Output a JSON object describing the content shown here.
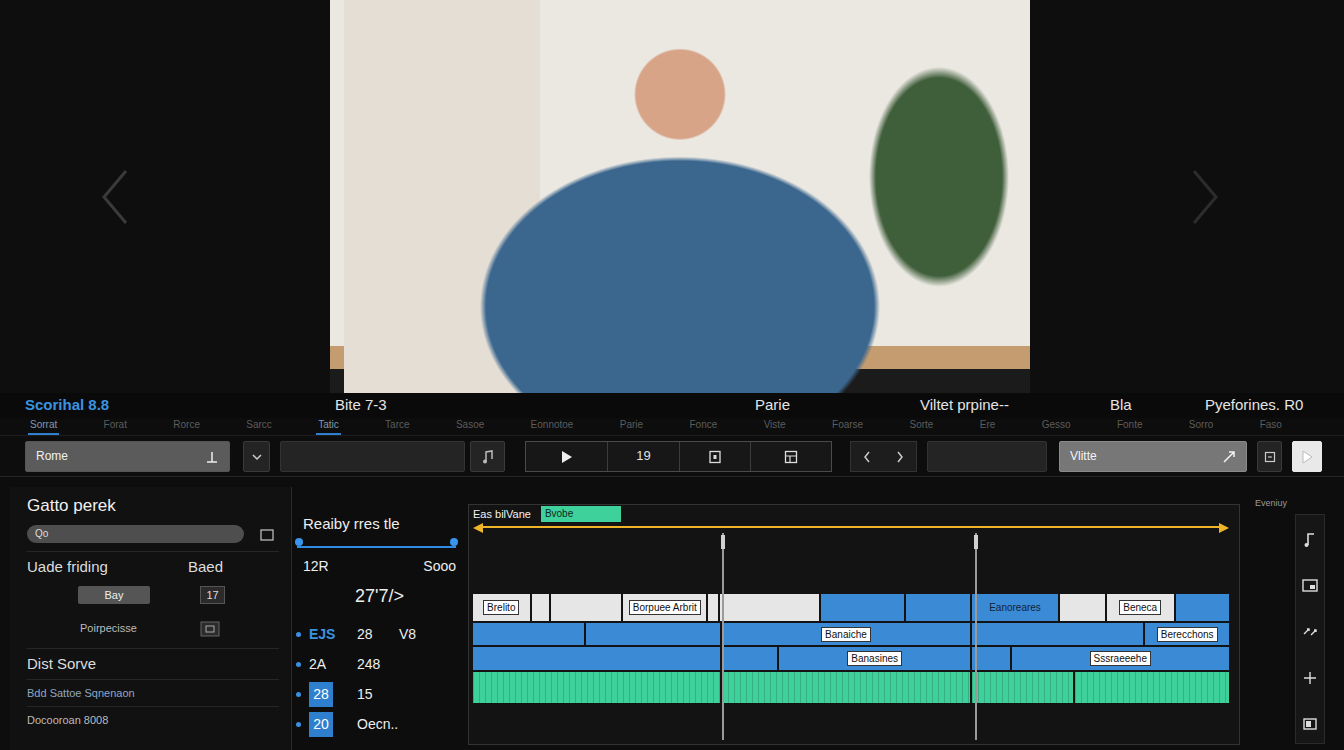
{
  "info_bar": [
    "Scorihal 8.8",
    "Bite  7-3",
    "Parie",
    "Viltet prpine--",
    "Bla",
    "Pyeforines. R0"
  ],
  "tabs": [
    {
      "label": "Sorrat",
      "selected": true
    },
    {
      "label": "Forat",
      "selected": false
    },
    {
      "label": "Rorce",
      "selected": false
    },
    {
      "label": "Sarcc",
      "selected": false
    },
    {
      "label": "Tatic",
      "selected": true
    },
    {
      "label": "Tarce",
      "selected": false
    },
    {
      "label": "Sasoe",
      "selected": false
    },
    {
      "label": "Eonnotoe",
      "selected": false
    },
    {
      "label": "Parie",
      "selected": false
    },
    {
      "label": "Fonce",
      "selected": false
    },
    {
      "label": "Viste",
      "selected": false
    },
    {
      "label": "Foarse",
      "selected": false
    },
    {
      "label": "Sorte",
      "selected": false
    },
    {
      "label": "Ere",
      "selected": false
    },
    {
      "label": "Gesso",
      "selected": false
    },
    {
      "label": "Fonte",
      "selected": false
    },
    {
      "label": "Sorro",
      "selected": false
    },
    {
      "label": "Faso",
      "selected": false
    }
  ],
  "toolbar": {
    "source": "Rome",
    "counter": "19",
    "target": "Vlitte"
  },
  "inspector": {
    "title": "Gatto perek",
    "search": "Qo",
    "row_label": "Uade friding",
    "row_value": "Baed",
    "button": "Bay",
    "button_value": "17",
    "option": "Poirpecisse",
    "section": "Dist Sorve",
    "links": [
      "Bdd Sattoe Sqnenaon",
      "Docooroan 8008"
    ]
  },
  "properties": {
    "title": "Reaiby rres tle",
    "slider": {
      "level": 1
    },
    "min": "12R",
    "max": "Sooo",
    "value": "27'7/>",
    "rows": [
      {
        "kind": "accent",
        "cells": [
          "EJS",
          "28",
          "V8"
        ]
      },
      {
        "kind": "plain",
        "cells": [
          "2A",
          "248"
        ]
      },
      {
        "kind": "boxed",
        "cells": [
          "28",
          "15"
        ]
      },
      {
        "kind": "boxed",
        "cells": [
          "20",
          "Oecn.."
        ]
      }
    ]
  },
  "timeline": {
    "title": "Eas bilVane",
    "tag": "Bvobe",
    "tracks": [
      {
        "kind": "video",
        "clips": [
          {
            "kind": "tag",
            "label": "Brelito",
            "length": 56,
            "color": "#e6e6e6"
          },
          {
            "kind": "plain",
            "length": 17,
            "color": "#e6e6e6"
          },
          {
            "kind": "plain",
            "length": 70,
            "color": "#e6e6e6"
          },
          {
            "kind": "tag",
            "label": "Borpuee Arbrit",
            "length": 82,
            "color": "#e6e6e6"
          },
          {
            "kind": "plain",
            "length": 10,
            "color": "#e6e6e6"
          },
          {
            "kind": "plain",
            "length": 98,
            "color": "#e6e6e6"
          },
          {
            "kind": "plain",
            "length": 82,
            "color": "#3b8ad6"
          },
          {
            "kind": "plain",
            "length": 63,
            "color": "#3b8ad6"
          },
          {
            "kind": "text",
            "label": "Eanoreares",
            "length": 86,
            "color": "#3b8ad6"
          },
          {
            "kind": "plain",
            "length": 44,
            "color": "#e6e6e6"
          },
          {
            "kind": "tag",
            "label": "Beneca",
            "length": 66,
            "color": "#e6e6e6"
          },
          {
            "kind": "plain",
            "length": 53,
            "color": "#3b8ad6"
          }
        ]
      },
      {
        "kind": "video",
        "clips": [
          {
            "kind": "plain",
            "length": 110,
            "color": "#3b8ad6"
          },
          {
            "kind": "plain",
            "length": 133,
            "color": "#3b8ad6"
          },
          {
            "kind": "tag",
            "label": "Banaiche",
            "length": 247,
            "color": "#3b8ad6"
          },
          {
            "kind": "plain",
            "length": 170,
            "color": "#3b8ad6"
          },
          {
            "kind": "tag",
            "label": "Berecchons",
            "length": 83,
            "color": "#3b8ad6"
          }
        ]
      },
      {
        "kind": "video",
        "clips": [
          {
            "kind": "plain",
            "length": 245,
            "color": "#3b8ad6"
          },
          {
            "kind": "plain",
            "length": 55,
            "color": "#3b8ad6"
          },
          {
            "kind": "tag",
            "label": "Banasines",
            "length": 190,
            "color": "#3b8ad6"
          },
          {
            "kind": "plain",
            "length": 37,
            "color": "#3b8ad6"
          },
          {
            "kind": "tag",
            "label": "Sssraeeehe",
            "length": 216,
            "color": "#3b8ad6"
          }
        ]
      },
      {
        "kind": "audio",
        "clips": [
          {
            "kind": "plain",
            "length": 245,
            "color": "#3fd19c"
          },
          {
            "kind": "plain",
            "length": 247,
            "color": "#3fd19c"
          },
          {
            "kind": "plain",
            "length": 100,
            "color": "#3fd19c"
          },
          {
            "kind": "plain",
            "length": 153,
            "color": "#3fd19c"
          }
        ]
      }
    ]
  },
  "side_label": "Eveniuy"
}
